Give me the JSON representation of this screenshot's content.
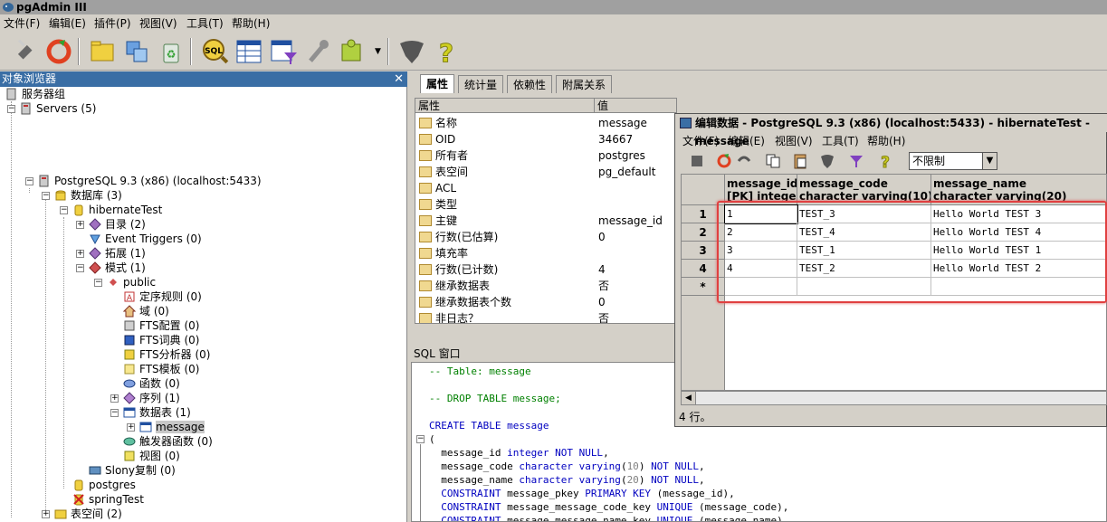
{
  "app": {
    "title": "pgAdmin III"
  },
  "menu": [
    "文件(F)",
    "编辑(E)",
    "插件(P)",
    "视图(V)",
    "工具(T)",
    "帮助(H)"
  ],
  "object_browser": {
    "title": "对象浏览器",
    "close": "✕",
    "nodes": [
      {
        "label": "服务器组"
      },
      {
        "label": "Servers (5)"
      },
      {
        "label": "PostgreSQL 9.3 (x86) (localhost:5433)"
      },
      {
        "label": "数据库 (3)"
      },
      {
        "label": "hibernateTest"
      },
      {
        "label": "目录 (2)"
      },
      {
        "label": "Event Triggers (0)"
      },
      {
        "label": "拓展 (1)"
      },
      {
        "label": "模式 (1)"
      },
      {
        "label": "public"
      },
      {
        "label": "定序规则 (0)"
      },
      {
        "label": "域 (0)"
      },
      {
        "label": "FTS配置 (0)"
      },
      {
        "label": "FTS词典 (0)"
      },
      {
        "label": "FTS分析器 (0)"
      },
      {
        "label": "FTS模板 (0)"
      },
      {
        "label": "函数 (0)"
      },
      {
        "label": "序列 (1)"
      },
      {
        "label": "数据表 (1)"
      },
      {
        "label": "message"
      },
      {
        "label": "触发器函数 (0)"
      },
      {
        "label": "视图 (0)"
      },
      {
        "label": "Slony复制 (0)"
      },
      {
        "label": "postgres"
      },
      {
        "label": "springTest"
      },
      {
        "label": "表空间 (2)"
      }
    ]
  },
  "tabs": [
    "属性",
    "统计量",
    "依赖性",
    "附属关系"
  ],
  "properties": {
    "headers": [
      "属性",
      "值"
    ],
    "rows": [
      {
        "k": "名称",
        "v": "message"
      },
      {
        "k": "OID",
        "v": "34667"
      },
      {
        "k": "所有者",
        "v": "postgres"
      },
      {
        "k": "表空间",
        "v": "pg_default"
      },
      {
        "k": "ACL",
        "v": ""
      },
      {
        "k": "类型",
        "v": ""
      },
      {
        "k": "主键",
        "v": "message_id"
      },
      {
        "k": "行数(已估算)",
        "v": "0"
      },
      {
        "k": "填充率",
        "v": ""
      },
      {
        "k": "行数(已计数)",
        "v": "4"
      },
      {
        "k": "继承数据表",
        "v": "否"
      },
      {
        "k": "继承数据表个数",
        "v": "0"
      },
      {
        "k": "非日志？",
        "v": "否"
      }
    ]
  },
  "sql_window": {
    "title": "SQL 窗口",
    "lines": [
      "-- Table: message",
      "",
      "-- DROP TABLE message;",
      "",
      "CREATE TABLE message",
      "(",
      "  message_id integer NOT NULL,",
      "  message_code character varying(10) NOT NULL,",
      "  message_name character varying(20) NOT NULL,",
      "  CONSTRAINT message_pkey PRIMARY KEY (message_id),",
      "  CONSTRAINT message_message_code_key UNIQUE (message_code),",
      "  CONSTRAINT message_message_name_key UNIQUE (message_name)"
    ]
  },
  "edit_window": {
    "title": "编辑数据 - PostgreSQL 9.3 (x86) (localhost:5433) - hibernateTest - message",
    "menu": [
      "文件(F)",
      "编辑(E)",
      "视图(V)",
      "工具(T)",
      "帮助(H)"
    ],
    "limit": "不限制",
    "columns": [
      {
        "name": "message_id",
        "type": "[PK] integer"
      },
      {
        "name": "message_code",
        "type": "character varying(10)"
      },
      {
        "name": "message_name",
        "type": "character varying(20)"
      }
    ],
    "rows": [
      {
        "n": "1",
        "cells": [
          "1",
          "TEST_3",
          "Hello World TEST 3"
        ]
      },
      {
        "n": "2",
        "cells": [
          "2",
          "TEST_4",
          "Hello World TEST 4"
        ]
      },
      {
        "n": "3",
        "cells": [
          "3",
          "TEST_1",
          "Hello World TEST 1"
        ]
      },
      {
        "n": "4",
        "cells": [
          "4",
          "TEST_2",
          "Hello World TEST 2"
        ]
      }
    ],
    "new_row_marker": "*",
    "status": "4 行。"
  },
  "colors": {
    "panel_header": "#3a6ea5",
    "highlight_box": "#e04040",
    "sql_comment": "#008000",
    "sql_keyword": "#0000c0"
  }
}
